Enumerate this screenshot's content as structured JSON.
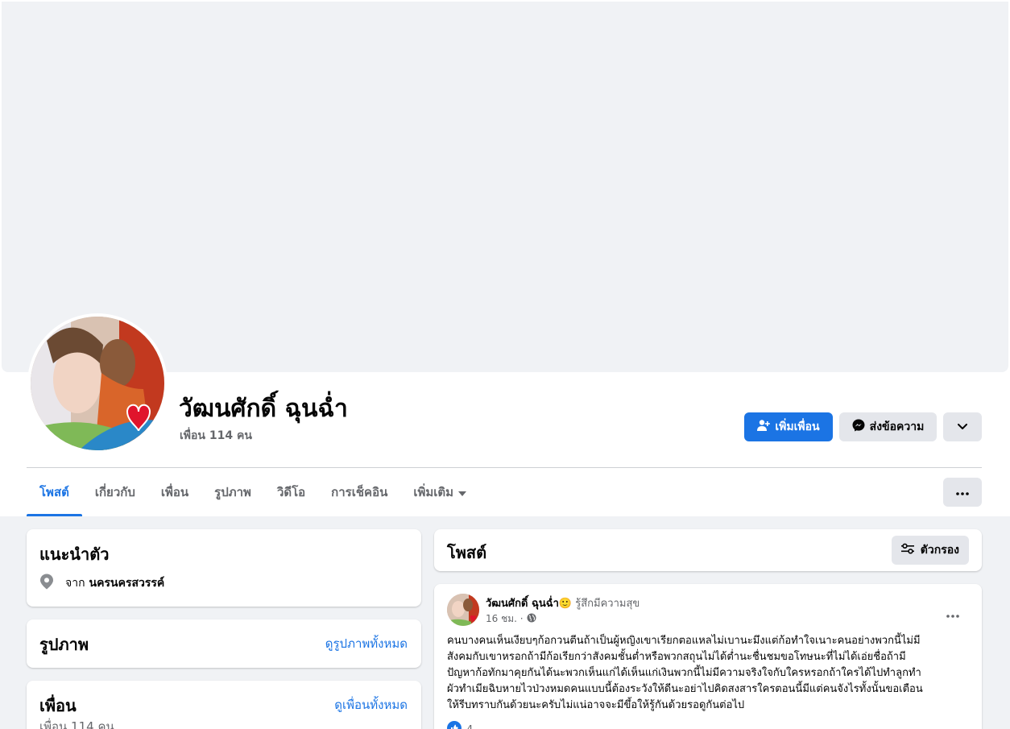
{
  "profile": {
    "name": "วัฒนศักดิ์ ฉุนฉ่ำ",
    "friends_count": "เพื่อน 114 คน"
  },
  "actions": {
    "add_friend": "เพิ่มเพื่อน",
    "message": "ส่งข้อความ"
  },
  "tabs": [
    {
      "label": "โพสต์",
      "active": true
    },
    {
      "label": "เกี่ยวกับ"
    },
    {
      "label": "เพื่อน"
    },
    {
      "label": "รูปภาพ"
    },
    {
      "label": "วิดีโอ"
    },
    {
      "label": "การเช็คอิน"
    },
    {
      "label": "เพิ่มเติม"
    }
  ],
  "intro": {
    "title": "แนะนำตัว",
    "from_prefix": "จาก",
    "from_place": "นครนครสวรรค์"
  },
  "photos": {
    "title": "รูปภาพ",
    "see_all": "ดูรูปภาพทั้งหมด"
  },
  "friends": {
    "title": "เพื่อน",
    "see_all": "ดูเพื่อนทั้งหมด",
    "count": "เพื่อน 114 คน"
  },
  "posts": {
    "title": "โพสต์",
    "filter_label": "ตัวกรอง"
  },
  "post": {
    "author": "วัฒนศักดิ์ ฉุนฉ่ำ",
    "feeling_emoji": "🙂",
    "feeling": "รู้สึกมีความสุข",
    "time": "16 ชม. ·",
    "lines": [
      "คนบางคนเห็นเงียบๆก้อกวนตีนถ้าเป็นผู้หญิงเขาเรียกตอแหลไม่เบานะมึงแต่ก้อทำใจเนาะคนอย่างพวกนี้ไม่มี",
      "สังคมกับเขาหรอกถ้ามีก้อเรียกว่าสังคมชั้นต่ำหรือพวกสถุนไม่ได้ต่ำนะชื่นชมขอโทษนะที่ไม่ได้เอ่ยชื่อถ้ามี",
      "ปัญหาก้อทักมาคุยกันได้นะพวกเห็นแก่ได้เห็นแก่เงินพวกนี้ไม่มีความจริงใจกับใครหรอกถ้าใครได้ไปทำลูกทำ",
      "ผัวทำเมียฉิบหายไวป่วงหมดคนแบบนี้ต้องระวังให้ดีนะอย่าไปคิดสงสารใครตอนนี้มีแต่คนจังไรทั้งนั้นขอเตือน",
      "ให้รีบทราบกันด้วยนะครับไม่แน่อาจจะมีขึ้อให้รู้กันด้วยรอดูกันต่อไป"
    ],
    "reaction_count": "4"
  },
  "colors": {
    "accent": "#1b74e4",
    "page_bg": "#f0f2f5",
    "secondary_btn": "#e4e6eb",
    "muted_text": "#65676b"
  },
  "icons": {
    "add_friend": "person-plus-icon",
    "message": "messenger-icon",
    "more": "chevron-down-icon",
    "location": "location-pin-icon",
    "filter": "sliders-icon",
    "privacy": "globe-icon"
  }
}
